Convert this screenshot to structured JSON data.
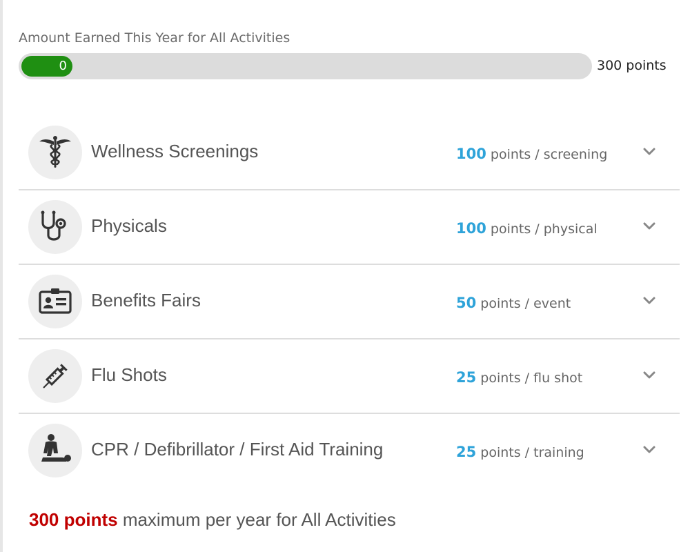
{
  "progress": {
    "title": "Amount Earned This Year for All Activities",
    "current_value": "0",
    "max_label": "300 points",
    "fill_fraction": 0.09
  },
  "activities": [
    {
      "name": "Wellness Screenings",
      "points": "100",
      "unit": "points / screening",
      "icon": "caduceus-icon"
    },
    {
      "name": "Physicals",
      "points": "100",
      "unit": "points / physical",
      "icon": "stethoscope-icon"
    },
    {
      "name": "Benefits Fairs",
      "points": "50",
      "unit": "points / event",
      "icon": "id-badge-icon"
    },
    {
      "name": "Flu Shots",
      "points": "25",
      "unit": "points / flu shot",
      "icon": "syringe-icon"
    },
    {
      "name": "CPR / Defibrillator / First Aid Training",
      "points": "25",
      "unit": "points / training",
      "icon": "cpr-icon"
    }
  ],
  "footer": {
    "strong_text": "300 points",
    "rest_text": " maximum per year for All Activities"
  },
  "colors": {
    "progress_fill": "#1f8f12",
    "points_accent": "#2ea3d9",
    "footer_accent": "#c00000"
  }
}
